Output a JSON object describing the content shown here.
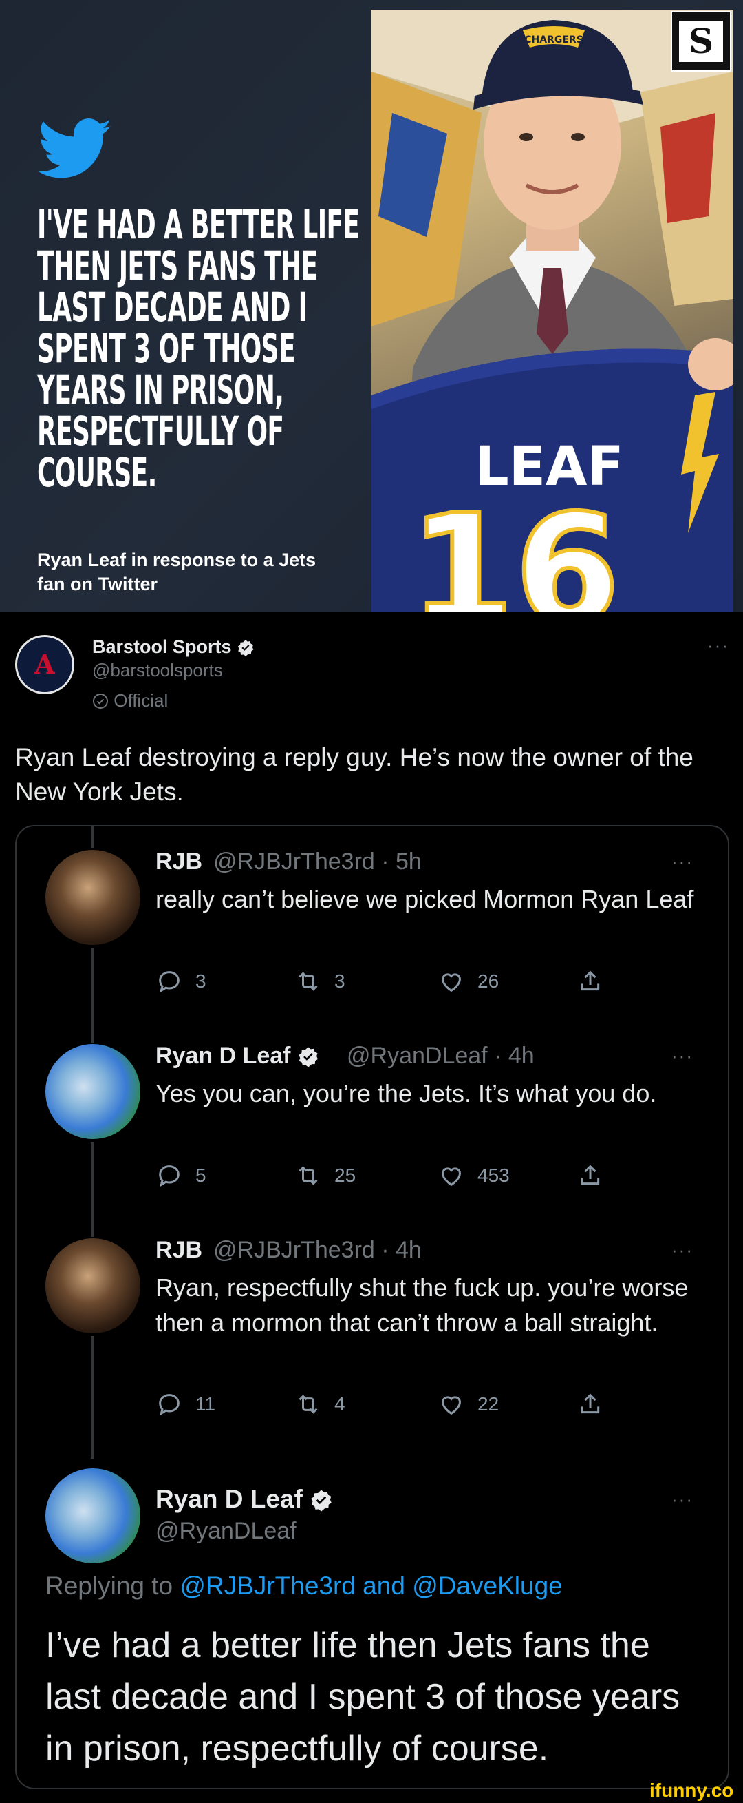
{
  "graphic": {
    "headline": "I'VE HAD A BETTER LIFE THEN JETS FANS THE LAST DECADE AND I SPENT 3 OF THOSE YEARS IN PRISON, RESPECTFULLY OF COURSE.",
    "caption": "Ryan Leaf in response to a Jets fan on Twitter",
    "jersey_name": "LEAF",
    "jersey_number": "16",
    "hat_text": "CHARGERS",
    "logo_letter": "S"
  },
  "tweet": {
    "author_name": "Barstool Sports",
    "author_handle": "@barstoolsports",
    "official_label": "Official",
    "avatar_letter": "A",
    "text": "Ryan Leaf destroying a reply guy. He’s now the owner of the New York Jets."
  },
  "replies": [
    {
      "name": "RJB",
      "meta": "@RJBJrThe3rd · 5h",
      "text": "really can’t believe we picked Mormon Ryan Leaf",
      "replies": "3",
      "retweets": "3",
      "likes": "26"
    },
    {
      "name": "Ryan D Leaf",
      "meta": "@RyanDLeaf · 4h",
      "text": "Yes you can, you’re the Jets. It’s what you do.",
      "replies": "5",
      "retweets": "25",
      "likes": "453"
    },
    {
      "name": "RJB",
      "meta": "@RJBJrThe3rd · 4h",
      "text": "Ryan, respectfully shut the fuck up. you’re worse then a mormon that can’t throw a ball straight.",
      "replies": "11",
      "retweets": "4",
      "likes": "22"
    }
  ],
  "final_tweet": {
    "name": "Ryan D Leaf",
    "handle": "@RyanDLeaf",
    "replying_prefix": "Replying to",
    "replying_to": "@RJBJrThe3rd and @DaveKluge",
    "text": "I’ve had a better life then Jets fans the last decade and I spent 3 of those years in prison, respectfully of course."
  },
  "more_label": "···",
  "watermark": "ifunny.co",
  "colors": {
    "accent": "#1d9bf0",
    "background": "#000000",
    "muted": "#71767b",
    "twitter_bird": "#1d9bf0"
  },
  "icons": [
    "twitter-bird-icon",
    "verified-badge-icon",
    "reply-icon",
    "retweet-icon",
    "like-icon",
    "share-icon",
    "more-icon",
    "official-check-icon"
  ]
}
